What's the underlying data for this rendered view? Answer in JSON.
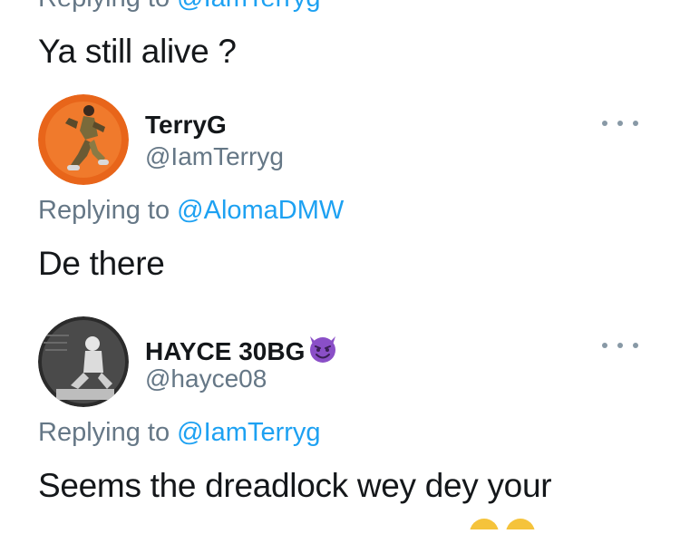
{
  "thread": {
    "top_tweet": {
      "replying_prefix": "Replying to",
      "replying_handle": "@IamTerryg",
      "text": "Ya still alive ?"
    },
    "tweets": [
      {
        "display_name": "TerryG",
        "username": "@IamTerryg",
        "replying_prefix": "Replying to",
        "replying_handle": "@AlomaDMW",
        "text": "De there",
        "avatar_icon": "person-jumping-avatar",
        "avatar_bg": "#e8651a"
      },
      {
        "display_name": "HAYCE 30BG",
        "name_emoji_icon": "smiling-devil-emoji",
        "username": "@hayce08",
        "replying_prefix": "Replying to",
        "replying_handle": "@IamTerryg",
        "text": "Seems the dreadlock wey dey your",
        "avatar_icon": "person-sitting-avatar",
        "avatar_bg": "#2b2b2b"
      }
    ],
    "more_icon": "more-options-icon"
  },
  "colors": {
    "link": "#1da1f2",
    "secondary_text": "#657786",
    "primary_text": "#14171a",
    "devil_emoji": "#8a4fc7"
  }
}
